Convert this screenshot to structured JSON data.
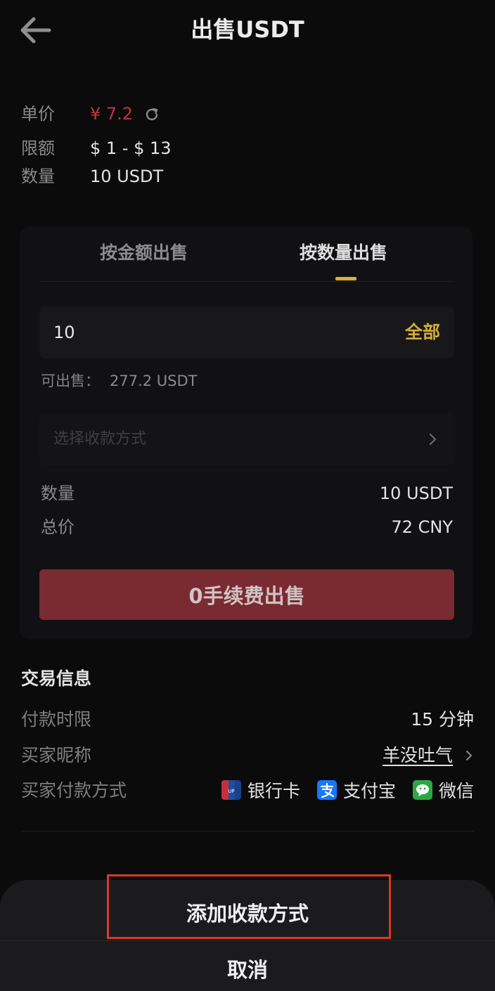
{
  "header": {
    "title": "出售USDT"
  },
  "info": {
    "price_label": "单价",
    "price_value": "¥ 7.2",
    "limit_label": "限额",
    "limit_value": "$ 1 - $ 13",
    "quantity_label": "数量",
    "quantity_value": "10 USDT"
  },
  "sell_card": {
    "tabs": [
      {
        "label": "按金额出售",
        "active": false
      },
      {
        "label": "按数量出售",
        "active": true
      }
    ],
    "quantity_input": {
      "value": "10"
    },
    "all_label": "全部",
    "available_label": "可出售：",
    "available_value": "277.2 USDT",
    "payment_placeholder": "选择收款方式",
    "summary": {
      "quantity_label": "数量",
      "quantity_value": "10 USDT",
      "total_label": "总价",
      "total_value": "72 CNY"
    },
    "sell_button": "0手续费出售"
  },
  "trade_info": {
    "title": "交易信息",
    "payment_time_label": "付款时限",
    "payment_time_value": "15 分钟",
    "buyer_nickname_label": "买家昵称",
    "buyer_nickname_value": "羊没吐气",
    "buyer_payment_label": "买家付款方式",
    "payment_methods": [
      {
        "label": "银行卡",
        "icon": "bank-card-icon",
        "color": "#1d4fa0"
      },
      {
        "label": "支付宝",
        "icon": "alipay-icon",
        "color": "#1677ff"
      },
      {
        "label": "微信",
        "icon": "wechat-icon",
        "color": "#2aa845"
      }
    ]
  },
  "sheet": {
    "add_payment_label": "添加收款方式",
    "cancel_label": "取消"
  },
  "colors": {
    "accent_gold": "#d4ac38",
    "price_red": "#c0343f",
    "sell_button": "#7a2a31",
    "highlight": "#d83a26"
  }
}
